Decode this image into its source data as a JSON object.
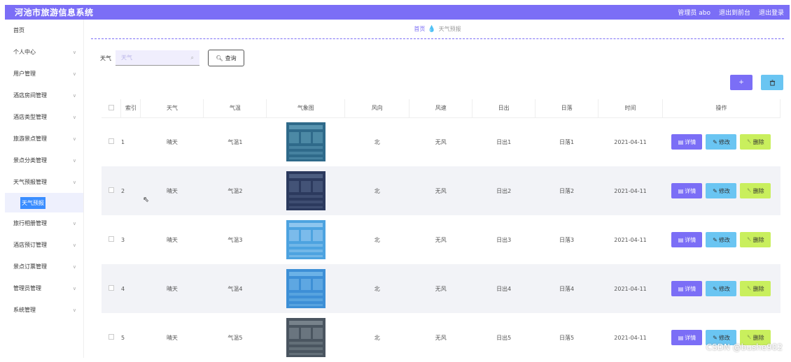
{
  "app": {
    "title": "河池市旅游信息系统",
    "top_links": [
      "管理员 abo",
      "退出到前台",
      "退出登录"
    ]
  },
  "sidebar": {
    "items": [
      {
        "label": "首页",
        "has_chevron": false
      },
      {
        "label": "个人中心",
        "has_chevron": true
      },
      {
        "label": "用户管理",
        "has_chevron": true
      },
      {
        "label": "酒店房间管理",
        "has_chevron": true
      },
      {
        "label": "酒店类型管理",
        "has_chevron": true
      },
      {
        "label": "旅游景点管理",
        "has_chevron": true
      },
      {
        "label": "景点分类管理",
        "has_chevron": true
      },
      {
        "label": "天气预报管理",
        "has_chevron": true
      },
      {
        "label": "旅行相册管理",
        "has_chevron": true
      },
      {
        "label": "酒店预订管理",
        "has_chevron": true
      },
      {
        "label": "景点订票管理",
        "has_chevron": true
      },
      {
        "label": "管理员管理",
        "has_chevron": true
      },
      {
        "label": "系统管理",
        "has_chevron": true
      }
    ],
    "active_sub": "天气预报"
  },
  "breadcrumb": {
    "home": "首页",
    "current": "天气预报"
  },
  "search": {
    "label": "天气",
    "placeholder": "天气",
    "button": "查询"
  },
  "actions": {
    "add": "+",
    "delete": "🗑"
  },
  "table": {
    "headers": [
      "索引",
      "天气",
      "气温",
      "气象图",
      "风向",
      "风速",
      "日出",
      "日落",
      "时间",
      "操作"
    ],
    "rows": [
      {
        "index": "1",
        "weather": "晴天",
        "temp": "气温1",
        "wind_dir": "北",
        "wind_speed": "无风",
        "sunrise": "日出1",
        "sunset": "日落1",
        "time": "2021-04-11"
      },
      {
        "index": "2",
        "weather": "晴天",
        "temp": "气温2",
        "wind_dir": "北",
        "wind_speed": "无风",
        "sunrise": "日出2",
        "sunset": "日落2",
        "time": "2021-04-11"
      },
      {
        "index": "3",
        "weather": "晴天",
        "temp": "气温3",
        "wind_dir": "北",
        "wind_speed": "无风",
        "sunrise": "日出3",
        "sunset": "日落3",
        "time": "2021-04-11"
      },
      {
        "index": "4",
        "weather": "晴天",
        "temp": "气温4",
        "wind_dir": "北",
        "wind_speed": "无风",
        "sunrise": "日出4",
        "sunset": "日落4",
        "time": "2021-04-11"
      },
      {
        "index": "5",
        "weather": "晴天",
        "temp": "气温5",
        "wind_dir": "北",
        "wind_speed": "无风",
        "sunrise": "日出5",
        "sunset": "日落5",
        "time": "2021-04-11"
      }
    ],
    "op_labels": {
      "detail": "详情",
      "edit": "修改",
      "delete": "删除"
    }
  },
  "watermark": "CSDN @bushe902",
  "colors": {
    "primary": "#7b6ef6",
    "edit": "#6ac5f2",
    "delete": "#c9ef5d"
  }
}
